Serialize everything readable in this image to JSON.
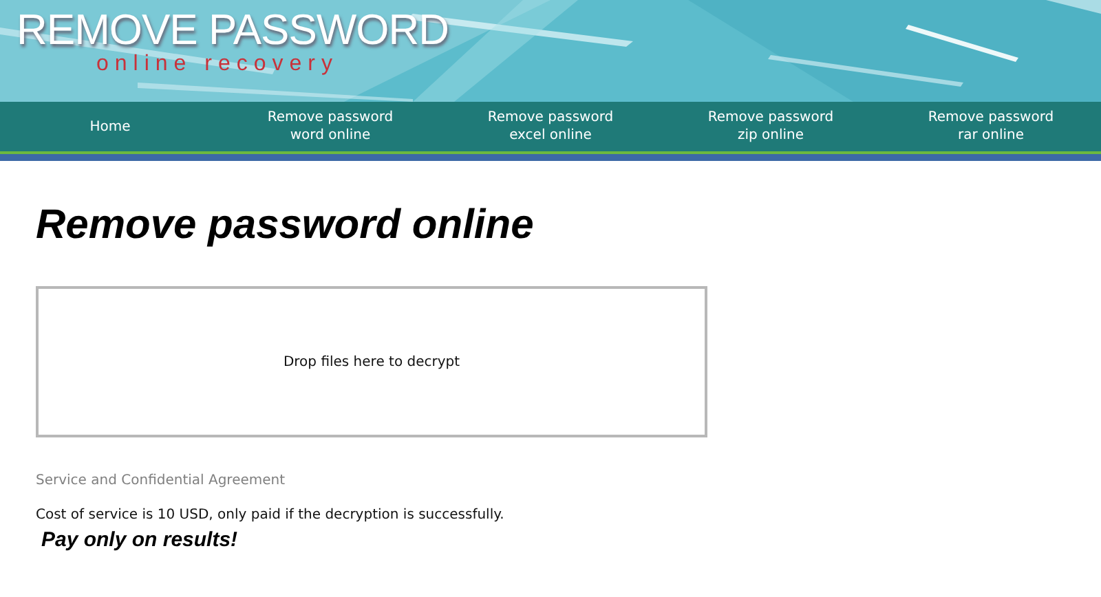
{
  "logo": {
    "title": "REMOVE PASSWORD",
    "subtitle": "online recovery"
  },
  "nav": [
    {
      "lines": [
        "Home"
      ]
    },
    {
      "lines": [
        "Remove password",
        "word online"
      ]
    },
    {
      "lines": [
        "Remove password",
        "excel online"
      ]
    },
    {
      "lines": [
        "Remove password",
        "zip online"
      ]
    },
    {
      "lines": [
        "Remove password",
        "rar online"
      ]
    }
  ],
  "heading": "Remove password online",
  "dropzone": {
    "text": "Drop files here to decrypt"
  },
  "agreement_link": "Service and Confidential Agreement",
  "cost_text": "Cost of service is 10 USD, only paid if the decryption is successfully.",
  "slogan": "Pay only on results!"
}
